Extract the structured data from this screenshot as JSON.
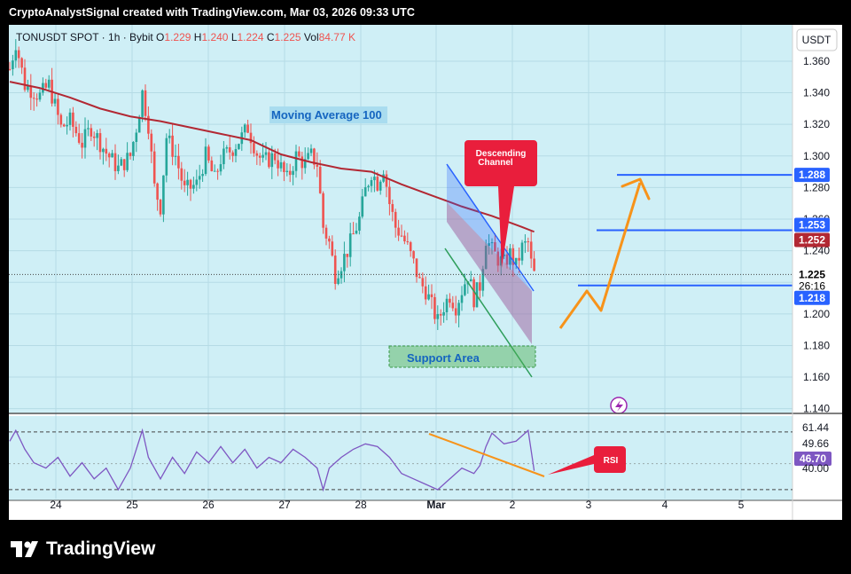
{
  "header": {
    "text": "CryptoAnalystSignal created with TradingView.com, Mar 03, 2026 09:33 UTC"
  },
  "symbol": {
    "name": "TONUSDT SPOT",
    "interval": "1h",
    "exchange": "Bybit",
    "o_label": "O",
    "o_value": "1.229",
    "h_label": "H",
    "h_value": "1.240",
    "l_label": "L",
    "l_value": "1.224",
    "c_label": "C",
    "c_value": "1.225",
    "vol_label": "Vol",
    "vol_value": "84.77 K"
  },
  "currency_button": "USDT",
  "price_labels": {
    "current": "1.225",
    "countdown": "26:16",
    "level_high": "1.288",
    "level_mid": "1.253",
    "ma_value": "1.252",
    "level_low": "1.218"
  },
  "rsi_labels": {
    "upper": "61.44",
    "mid": "49.66",
    "current": "46.70",
    "lower": "40.00"
  },
  "annotations": {
    "moving_average": "Moving Average 100",
    "descending_channel": "Descending Channel",
    "support_area": "Support Area",
    "rsi": "RSI"
  },
  "footer": {
    "brand": "TradingView"
  },
  "colors": {
    "bull": "#26a69a",
    "bear": "#ef5350",
    "ma": "#b22833",
    "blue": "#2962ff",
    "orange": "#f7931a",
    "rsi_line": "#7e57c2",
    "callout_red": "#e91e3c",
    "support_green": "#4caf50"
  },
  "chart_data": [
    {
      "type": "candlestick",
      "title": "TONUSDT SPOT · 1h · Bybit",
      "x_ticks": [
        "24",
        "25",
        "26",
        "27",
        "28",
        "Mar",
        "2",
        "3",
        "4",
        "5"
      ],
      "y_ticks": [
        1.14,
        1.16,
        1.18,
        1.2,
        1.22,
        1.24,
        1.26,
        1.28,
        1.3,
        1.32,
        1.34,
        1.36
      ],
      "y_tick_labels": [
        "1.140",
        "1.160",
        "1.180",
        "1.200",
        "1.220",
        "1.240",
        "1.260",
        "1.280",
        "1.300",
        "1.320",
        "1.340",
        "1.360"
      ],
      "ylim": [
        1.137,
        1.383
      ],
      "grid": true,
      "close_path": [
        [
          0,
          1.355
        ],
        [
          2,
          1.372
        ],
        [
          5,
          1.345
        ],
        [
          10,
          1.338
        ],
        [
          13,
          1.345
        ],
        [
          17,
          1.318
        ],
        [
          20,
          1.322
        ],
        [
          24,
          1.308
        ],
        [
          27,
          1.318
        ],
        [
          32,
          1.302
        ],
        [
          36,
          1.292
        ],
        [
          40,
          1.3
        ],
        [
          42,
          1.318
        ],
        [
          44,
          1.34
        ],
        [
          46,
          1.32
        ],
        [
          48,
          1.28
        ],
        [
          50,
          1.268
        ],
        [
          52,
          1.312
        ],
        [
          55,
          1.3
        ],
        [
          58,
          1.278
        ],
        [
          62,
          1.282
        ],
        [
          65,
          1.3
        ],
        [
          68,
          1.285
        ],
        [
          70,
          1.298
        ],
        [
          74,
          1.305
        ],
        [
          77,
          1.312
        ],
        [
          79,
          1.318
        ],
        [
          82,
          1.302
        ],
        [
          84,
          1.296
        ],
        [
          88,
          1.3
        ],
        [
          92,
          1.285
        ],
        [
          95,
          1.3
        ],
        [
          98,
          1.295
        ],
        [
          100,
          1.3
        ],
        [
          102,
          1.295
        ],
        [
          104,
          1.255
        ],
        [
          106,
          1.245
        ],
        [
          108,
          1.225
        ],
        [
          110,
          1.232
        ],
        [
          112,
          1.24
        ],
        [
          114,
          1.25
        ],
        [
          116,
          1.26
        ],
        [
          118,
          1.278
        ],
        [
          120,
          1.29
        ],
        [
          122,
          1.283
        ],
        [
          124,
          1.293
        ],
        [
          126,
          1.27
        ],
        [
          128,
          1.255
        ],
        [
          130,
          1.25
        ],
        [
          132,
          1.242
        ],
        [
          134,
          1.232
        ],
        [
          136,
          1.22
        ],
        [
          138,
          1.215
        ],
        [
          140,
          1.205
        ],
        [
          142,
          1.195
        ],
        [
          144,
          1.205
        ],
        [
          146,
          1.212
        ],
        [
          148,
          1.205
        ],
        [
          150,
          1.215
        ],
        [
          152,
          1.225
        ],
        [
          154,
          1.21
        ],
        [
          156,
          1.218
        ],
        [
          158,
          1.248
        ],
        [
          160,
          1.24
        ],
        [
          162,
          1.235
        ],
        [
          164,
          1.232
        ],
        [
          166,
          1.238
        ],
        [
          168,
          1.23
        ],
        [
          170,
          1.242
        ],
        [
          172,
          1.245
        ],
        [
          173,
          1.232
        ],
        [
          174,
          1.225
        ]
      ],
      "moving_average_100": [
        [
          0,
          1.347
        ],
        [
          10,
          1.343
        ],
        [
          20,
          1.337
        ],
        [
          30,
          1.33
        ],
        [
          40,
          1.325
        ],
        [
          50,
          1.322
        ],
        [
          60,
          1.318
        ],
        [
          70,
          1.314
        ],
        [
          80,
          1.31
        ],
        [
          90,
          1.301
        ],
        [
          100,
          1.296
        ],
        [
          110,
          1.292
        ],
        [
          120,
          1.29
        ],
        [
          130,
          1.282
        ],
        [
          140,
          1.275
        ],
        [
          150,
          1.268
        ],
        [
          160,
          1.262
        ],
        [
          170,
          1.255
        ],
        [
          174,
          1.252
        ]
      ],
      "horizontal_levels": [
        1.288,
        1.253,
        1.218
      ],
      "current_price": 1.225
    },
    {
      "type": "line",
      "title": "RSI",
      "ylim": [
        38,
        66
      ],
      "guides": [
        61.44,
        40.0
      ],
      "current": 46.7,
      "values": [
        [
          0,
          58
        ],
        [
          2,
          62
        ],
        [
          5,
          55
        ],
        [
          8,
          50
        ],
        [
          12,
          48
        ],
        [
          16,
          52
        ],
        [
          20,
          45
        ],
        [
          24,
          50
        ],
        [
          28,
          44
        ],
        [
          32,
          48
        ],
        [
          36,
          40
        ],
        [
          40,
          48
        ],
        [
          44,
          62
        ],
        [
          46,
          52
        ],
        [
          50,
          44
        ],
        [
          54,
          52
        ],
        [
          58,
          46
        ],
        [
          62,
          54
        ],
        [
          66,
          50
        ],
        [
          70,
          56
        ],
        [
          74,
          50
        ],
        [
          78,
          55
        ],
        [
          82,
          48
        ],
        [
          86,
          52
        ],
        [
          90,
          50
        ],
        [
          94,
          55
        ],
        [
          98,
          52
        ],
        [
          102,
          48
        ],
        [
          104,
          40
        ],
        [
          106,
          48
        ],
        [
          110,
          52
        ],
        [
          114,
          55
        ],
        [
          118,
          57
        ],
        [
          122,
          56
        ],
        [
          126,
          52
        ],
        [
          130,
          46
        ],
        [
          134,
          44
        ],
        [
          138,
          42
        ],
        [
          142,
          40
        ],
        [
          146,
          44
        ],
        [
          150,
          48
        ],
        [
          154,
          46
        ],
        [
          156,
          49
        ],
        [
          158,
          56
        ],
        [
          160,
          61
        ],
        [
          164,
          57
        ],
        [
          168,
          58
        ],
        [
          172,
          62
        ],
        [
          174,
          47
        ]
      ]
    }
  ]
}
